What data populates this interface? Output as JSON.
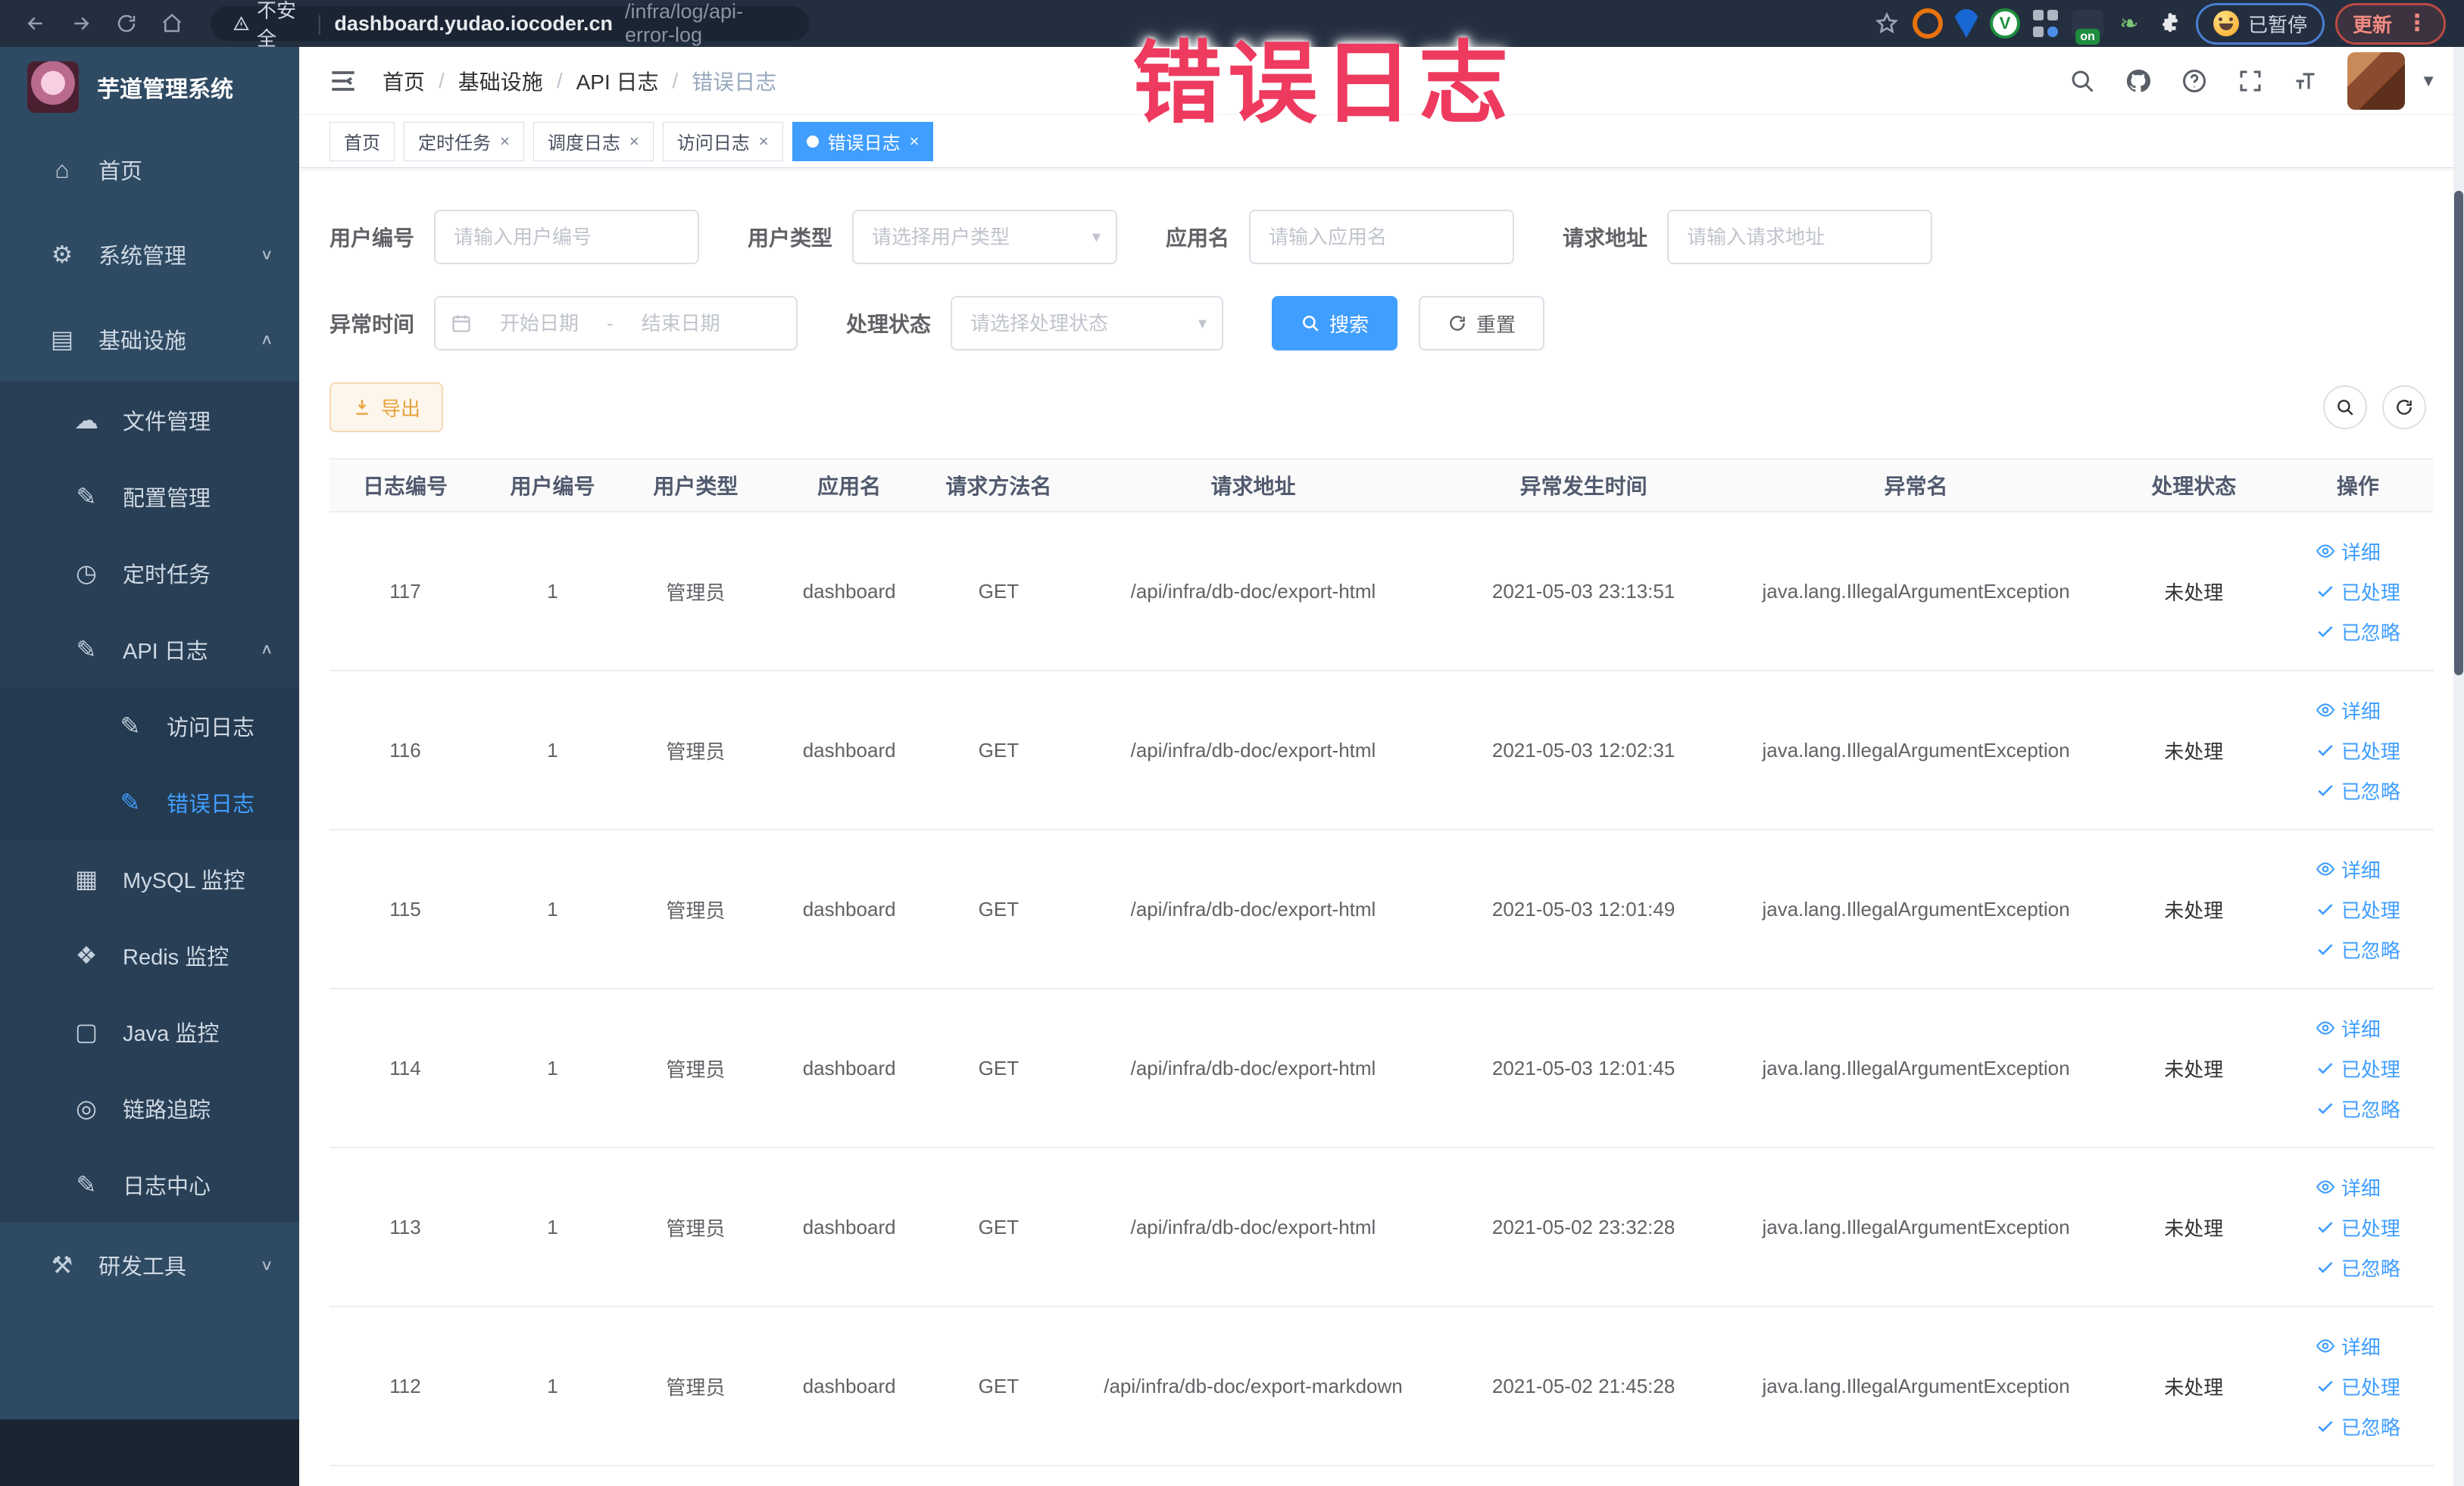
{
  "overlay": {
    "title": "错误日志"
  },
  "browser": {
    "security_label": "不安全",
    "url_host": "dashboard.yudao.iocoder.cn",
    "url_path": "/infra/log/api-error-log",
    "ext_on_badge": "on",
    "paused_badge": "已暂停",
    "update_badge": "更新",
    "menu_dots": "⋮"
  },
  "sidebar": {
    "logo_title": "芋道管理系统",
    "items": [
      {
        "label": "首页",
        "icon": "home-icon",
        "level": 1,
        "chevron": null,
        "active": false
      },
      {
        "label": "系统管理",
        "icon": "gear-icon",
        "level": 1,
        "chevron": "down",
        "active": false
      },
      {
        "label": "基础设施",
        "icon": "infrastructure-icon",
        "level": 1,
        "chevron": "up",
        "active": false
      },
      {
        "label": "文件管理",
        "icon": "file-icon",
        "level": 2,
        "chevron": null,
        "active": false
      },
      {
        "label": "配置管理",
        "icon": "edit-icon",
        "level": 2,
        "chevron": null,
        "active": false
      },
      {
        "label": "定时任务",
        "icon": "cron-icon",
        "level": 2,
        "chevron": null,
        "active": false
      },
      {
        "label": "API 日志",
        "icon": "edit-icon",
        "level": 2,
        "chevron": "up",
        "active": false
      },
      {
        "label": "访问日志",
        "icon": "edit-icon",
        "level": 3,
        "chevron": null,
        "active": false
      },
      {
        "label": "错误日志",
        "icon": "edit-icon",
        "level": 3,
        "chevron": null,
        "active": true
      },
      {
        "label": "MySQL 监控",
        "icon": "mysql-icon",
        "level": 2,
        "chevron": null,
        "active": false
      },
      {
        "label": "Redis 监控",
        "icon": "redis-icon",
        "level": 2,
        "chevron": null,
        "active": false
      },
      {
        "label": "Java 监控",
        "icon": "java-icon",
        "level": 2,
        "chevron": null,
        "active": false
      },
      {
        "label": "链路追踪",
        "icon": "trace-icon",
        "level": 2,
        "chevron": null,
        "active": false
      },
      {
        "label": "日志中心",
        "icon": "edit-icon",
        "level": 2,
        "chevron": null,
        "active": false
      },
      {
        "label": "研发工具",
        "icon": "devtools-icon",
        "level": 1,
        "chevron": "down",
        "active": false
      }
    ]
  },
  "header": {
    "breadcrumb": [
      "首页",
      "基础设施",
      "API 日志",
      "错误日志"
    ]
  },
  "tabs": [
    {
      "label": "首页",
      "closable": false,
      "active": false
    },
    {
      "label": "定时任务",
      "closable": true,
      "active": false
    },
    {
      "label": "调度日志",
      "closable": true,
      "active": false
    },
    {
      "label": "访问日志",
      "closable": true,
      "active": false
    },
    {
      "label": "错误日志",
      "closable": true,
      "active": true
    }
  ],
  "filters": {
    "user_id_label": "用户编号",
    "user_id_placeholder": "请输入用户编号",
    "user_type_label": "用户类型",
    "user_type_placeholder": "请选择用户类型",
    "app_name_label": "应用名",
    "app_name_placeholder": "请输入应用名",
    "request_url_label": "请求地址",
    "request_url_placeholder": "请输入请求地址",
    "exception_time_label": "异常时间",
    "start_date_placeholder": "开始日期",
    "range_separator": "-",
    "end_date_placeholder": "结束日期",
    "process_status_label": "处理状态",
    "process_status_placeholder": "请选择处理状态",
    "search_button": "搜索",
    "reset_button": "重置"
  },
  "toolbar": {
    "export_button": "导出"
  },
  "table": {
    "columns": [
      "日志编号",
      "用户编号",
      "用户类型",
      "应用名",
      "请求方法名",
      "请求地址",
      "异常发生时间",
      "异常名",
      "处理状态",
      "操作"
    ],
    "actions": [
      "详细",
      "已处理",
      "已忽略"
    ],
    "rows": [
      {
        "id": "117",
        "user_id": "1",
        "user_type": "管理员",
        "app": "dashboard",
        "method": "GET",
        "url": "/api/infra/db-doc/export-html",
        "time": "2021-05-03 23:13:51",
        "exception": "java.lang.IllegalArgumentException",
        "status": "未处理"
      },
      {
        "id": "116",
        "user_id": "1",
        "user_type": "管理员",
        "app": "dashboard",
        "method": "GET",
        "url": "/api/infra/db-doc/export-html",
        "time": "2021-05-03 12:02:31",
        "exception": "java.lang.IllegalArgumentException",
        "status": "未处理"
      },
      {
        "id": "115",
        "user_id": "1",
        "user_type": "管理员",
        "app": "dashboard",
        "method": "GET",
        "url": "/api/infra/db-doc/export-html",
        "time": "2021-05-03 12:01:49",
        "exception": "java.lang.IllegalArgumentException",
        "status": "未处理"
      },
      {
        "id": "114",
        "user_id": "1",
        "user_type": "管理员",
        "app": "dashboard",
        "method": "GET",
        "url": "/api/infra/db-doc/export-html",
        "time": "2021-05-03 12:01:45",
        "exception": "java.lang.IllegalArgumentException",
        "status": "未处理"
      },
      {
        "id": "113",
        "user_id": "1",
        "user_type": "管理员",
        "app": "dashboard",
        "method": "GET",
        "url": "/api/infra/db-doc/export-html",
        "time": "2021-05-02 23:32:28",
        "exception": "java.lang.IllegalArgumentException",
        "status": "未处理"
      },
      {
        "id": "112",
        "user_id": "1",
        "user_type": "管理员",
        "app": "dashboard",
        "method": "GET",
        "url": "/api/infra/db-doc/export-markdown",
        "time": "2021-05-02 21:45:28",
        "exception": "java.lang.IllegalArgumentException",
        "status": "未处理"
      }
    ]
  }
}
